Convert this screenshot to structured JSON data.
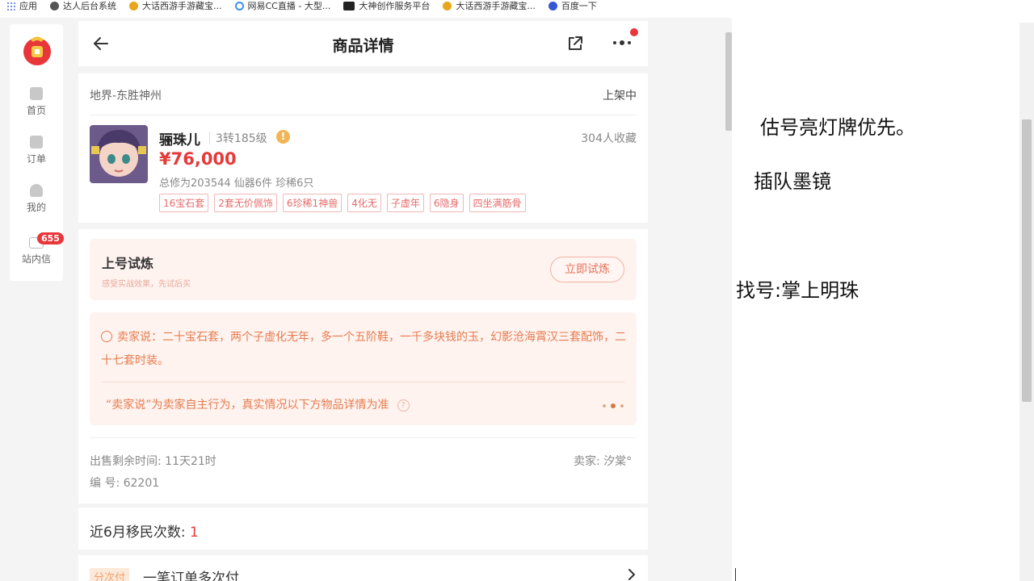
{
  "bookmarks": [
    {
      "label": "应用",
      "icon": "apps-grid-icon",
      "color": "#4a6fd6"
    },
    {
      "label": "达人后台系统",
      "icon": "globe-icon",
      "color": "#555555"
    },
    {
      "label": "大话西游手游藏宝...",
      "icon": "treasure-icon",
      "color": "#e8a61b"
    },
    {
      "label": "网易CC直播 - 大型...",
      "icon": "cc-live-icon",
      "color": "#3d8ff0"
    },
    {
      "label": "大神创作服务平台",
      "icon": "dashen-icon",
      "color": "#222222"
    },
    {
      "label": "大话西游手游藏宝...",
      "icon": "treasure-icon",
      "color": "#e8a61b"
    },
    {
      "label": "百度一下",
      "icon": "baidu-paw-icon",
      "color": "#3656d6"
    }
  ],
  "sidenav": {
    "items": [
      {
        "label": "首页",
        "icon": "home-icon"
      },
      {
        "label": "订单",
        "icon": "order-icon"
      },
      {
        "label": "我的",
        "icon": "user-icon"
      },
      {
        "label": "站内信",
        "icon": "mail-icon"
      }
    ],
    "badge": "655"
  },
  "header": {
    "title": "商品详情"
  },
  "item": {
    "server": "地界-东胜神州",
    "status": "上架中",
    "name": "骊珠儿",
    "level": "3转185级",
    "favorites": "304人收藏",
    "price": "¥76,000",
    "stats": "总修为203544  仙器6件  珍稀6只",
    "tags": [
      "16宝石套",
      "2套无价佩饰",
      "6珍稀1神兽",
      "4化无",
      "子虚年",
      "6隐身",
      "四坐满筋骨"
    ]
  },
  "trial": {
    "title": "上号试炼",
    "subtitle": "感受实战效果，先试后买",
    "button": "立即试炼"
  },
  "seller_says": {
    "text": "卖家说：二十宝石套，两个子虚化无年，多一个五阶鞋，一千多块钱的玉，幻影沧海霄汉三套配饰，二十七套时装。",
    "disclaimer": "“卖家说”为卖家自主行为，真实情况以下方物品详情为准"
  },
  "info": {
    "sale_time": "出售剩余时间: 11天21时",
    "seller": "卖家: 汐棠°",
    "serial": "编 号: 62201"
  },
  "migrate": {
    "label": "近6月移民次数:",
    "value": "1"
  },
  "pay": {
    "tag": "分次付",
    "text": "一笔订单多次付"
  },
  "notes": [
    "估号亮灯牌优先。",
    "插队墨镜",
    "找号:掌上明珠"
  ],
  "colors": {
    "accent_red": "#e63a3a",
    "seller_orange": "#e57c4e",
    "trial_bg": "#fff3f0"
  }
}
